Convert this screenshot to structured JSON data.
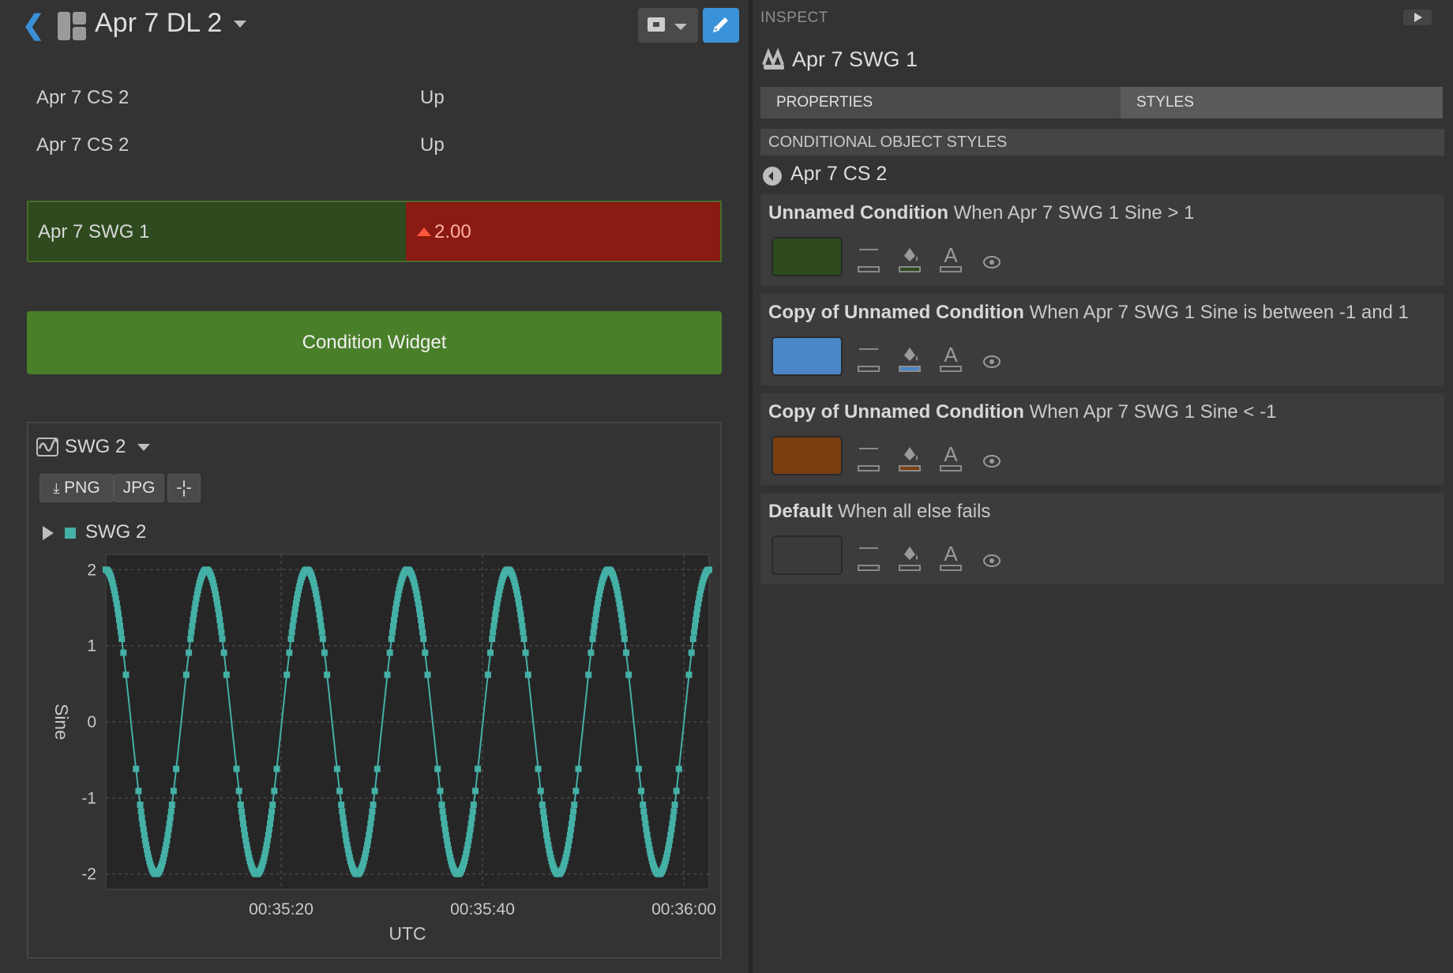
{
  "header": {
    "title": "Apr 7 DL 2"
  },
  "rows": [
    {
      "label": "Apr 7 CS 2",
      "value": "Up"
    },
    {
      "label": "Apr 7 CS 2",
      "value": "Up"
    }
  ],
  "swg_indicator": {
    "label": "Apr 7 SWG 1",
    "value": "2.00"
  },
  "condition_widget": {
    "label": "Condition Widget"
  },
  "chart_panel": {
    "title": "SWG 2",
    "buttons": {
      "png": "PNG",
      "jpg": "JPG"
    },
    "legend": "SWG 2"
  },
  "chart_data": {
    "type": "scatter",
    "xlabel": "UTC",
    "ylabel": "Sine",
    "x_tick_labels": [
      "00:35:20",
      "00:35:40",
      "00:36:00"
    ],
    "y_ticks": [
      2,
      1,
      0,
      -1,
      -2
    ],
    "ylim": [
      -2.2,
      2.2
    ],
    "grid": true,
    "series": [
      {
        "name": "SWG 2",
        "color": "#45b0a6",
        "amplitude": 2,
        "cycles": 6
      }
    ]
  },
  "inspect": {
    "label": "INSPECT",
    "object_title": "Apr 7 SWG 1",
    "tabs": [
      "PROPERTIES",
      "STYLES"
    ],
    "section_header": "CONDITIONAL OBJECT STYLES",
    "cs_title": "Apr 7 CS 2",
    "conditions": [
      {
        "name": "Unnamed Condition",
        "rule": "When Apr 7 SWG 1 Sine > 1",
        "color": "#2e4a1e"
      },
      {
        "name": "Copy of Unnamed Condition",
        "rule": "When Apr 7 SWG 1 Sine is between -1 and 1",
        "color": "#4a86c8"
      },
      {
        "name": "Copy of Unnamed Condition",
        "rule": "When Apr 7 SWG 1 Sine < -1",
        "color": "#7a3e10"
      },
      {
        "name": "Default",
        "rule": "When all else fails",
        "color": "#3a3a3a"
      }
    ]
  },
  "colors": {
    "accent": "#3a93d8",
    "data": "#45b0a6"
  }
}
